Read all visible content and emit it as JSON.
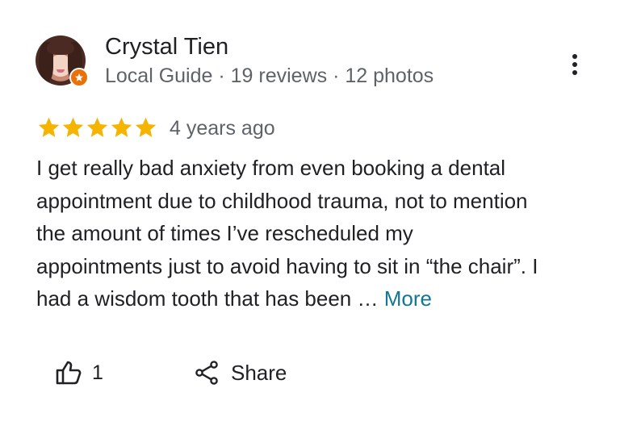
{
  "reviewer": {
    "name": "Crystal Tien",
    "meta": "Local Guide · 19 reviews · 12 photos",
    "avatar_icon": "reviewer-avatar",
    "badge_icon": "local-guide-star-icon",
    "badge_color": "#e8710a"
  },
  "menu": {
    "icon": "more-vert-icon"
  },
  "rating": {
    "stars": 5,
    "max_stars": 5,
    "star_color": "#f4b400",
    "time_ago": "4 years ago"
  },
  "review": {
    "lines": [
      "I get really bad anxiety from even booking a dental",
      "appointment due to childhood trauma, not to mention",
      "the amount of times I’ve rescheduled my",
      "appointments just to avoid having to sit in “the chair”. I",
      "had a wisdom tooth that has been … "
    ],
    "more_label": "More",
    "more_color": "#137699"
  },
  "actions": {
    "like_icon": "thumb-up-icon",
    "like_count": "1",
    "share_icon": "share-icon",
    "share_label": "Share"
  }
}
